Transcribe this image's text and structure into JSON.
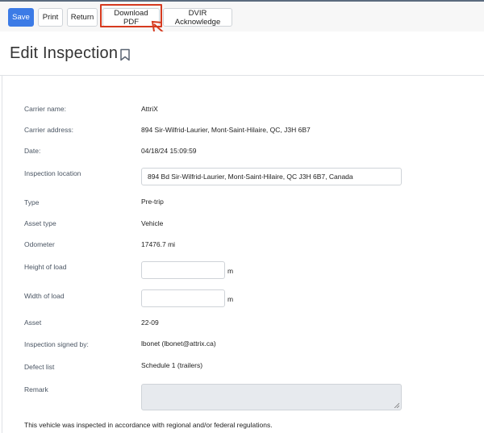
{
  "toolbar": {
    "save_label": "Save",
    "print_label": "Print",
    "return_label": "Return",
    "download_pdf_label": "Download PDF",
    "dvir_acknowledge_label": "DVIR Acknowledge"
  },
  "header": {
    "title": "Edit Inspection",
    "bookmark_icon": "bookmark-icon"
  },
  "form": {
    "carrier_name": {
      "label": "Carrier name:",
      "value": "AttriX"
    },
    "carrier_address": {
      "label": "Carrier address:",
      "value": "894 Sir-Wilfrid-Laurier, Mont-Saint-Hilaire, QC, J3H 6B7"
    },
    "date": {
      "label": "Date:",
      "value": "04/18/24 15:09:59"
    },
    "inspection_location": {
      "label": "Inspection location",
      "value": "894 Bd Sir-Wilfrid-Laurier, Mont-Saint-Hilaire, QC J3H 6B7, Canada"
    },
    "type": {
      "label": "Type",
      "value": "Pre-trip"
    },
    "asset_type": {
      "label": "Asset type",
      "value": "Vehicle"
    },
    "odometer": {
      "label": "Odometer",
      "value": "17476.7 mi"
    },
    "height_of_load": {
      "label": "Height of load",
      "value": "",
      "unit": "m"
    },
    "width_of_load": {
      "label": "Width of load",
      "value": "",
      "unit": "m"
    },
    "asset": {
      "label": "Asset",
      "value": "22-09"
    },
    "inspection_signed_by": {
      "label": "Inspection signed by:",
      "value": "lbonet (lbonet@attrix.ca)"
    },
    "defect_list": {
      "label": "Defect list",
      "value": "Schedule 1 (trailers)"
    },
    "remark": {
      "label": "Remark",
      "value": ""
    },
    "footer_text": "This vehicle was inspected in accordance with regional and/or federal regulations."
  },
  "colors": {
    "primary": "#3c7be6",
    "highlight": "#d63a1f"
  }
}
